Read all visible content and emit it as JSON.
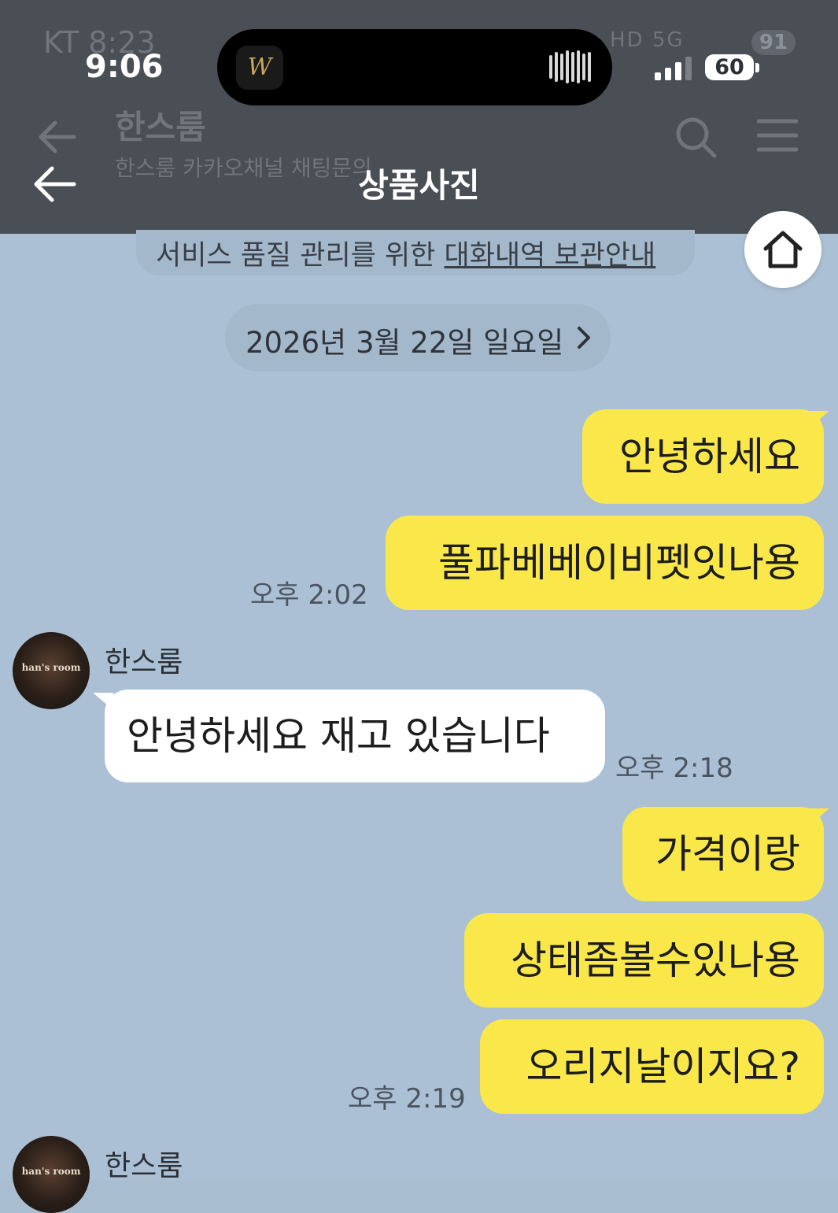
{
  "underlying": {
    "status_time": "KT 8:23",
    "status_right": "HD 5G",
    "battery": "91",
    "title": "한스룸",
    "subtitle": "한스룸 카카오채널 채팅문의"
  },
  "status_bar": {
    "time": "9:06",
    "battery": "60"
  },
  "island": {
    "app_glyph": "W"
  },
  "app_bar": {
    "title": "상품사진"
  },
  "notice": {
    "text": "서비스 품질 관리를 위한 ",
    "link": "대화내역 보관안내"
  },
  "date_divider": {
    "text": "2026년 3월 22일 일요일"
  },
  "messages": [
    {
      "from": "me",
      "text": "안녕하세요"
    },
    {
      "from": "me",
      "text": "풀파베베이비펫잇나용",
      "time": "오후 2:02"
    },
    {
      "from": "shop",
      "sender": "한스룸",
      "text": "안녕하세요 재고 있습니다",
      "time": "오후 2:18"
    },
    {
      "from": "me",
      "text": "가격이랑"
    },
    {
      "from": "me",
      "text": "상태좀볼수있나용"
    },
    {
      "from": "me",
      "text": "오리지날이지요?",
      "time": "오후 2:19"
    },
    {
      "from": "shop",
      "sender": "한스룸"
    }
  ],
  "avatar": {
    "text": "han's room"
  },
  "colors": {
    "chat_background": "#abc0d4",
    "my_bubble": "#fae84b",
    "their_bubble": "#ffffff",
    "header": "#4a4f55"
  },
  "icons": [
    "back-arrow-icon",
    "search-icon",
    "menu-icon",
    "home-icon",
    "chevron-right-icon",
    "signal-icon",
    "waveform-icon"
  ]
}
